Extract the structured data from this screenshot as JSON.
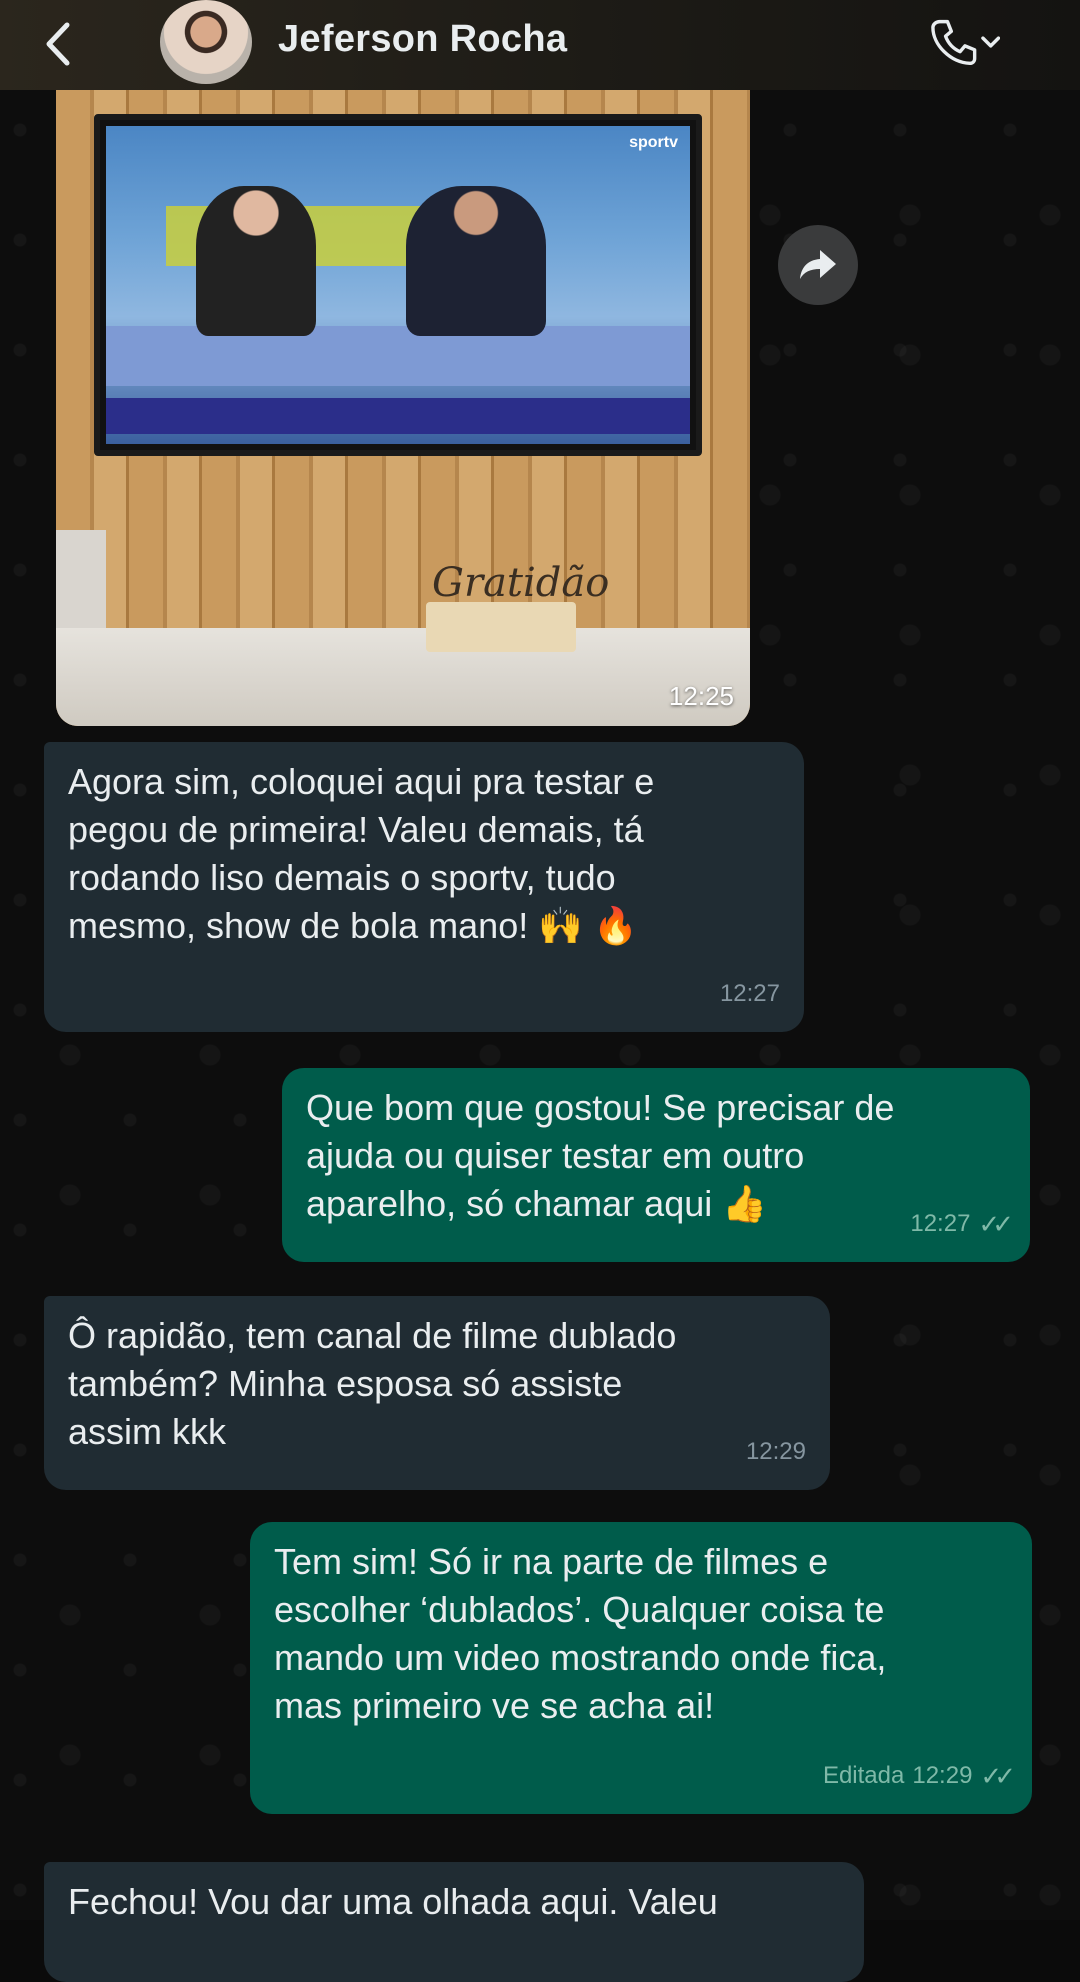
{
  "header": {
    "contact_name": "Jeferson Rocha",
    "back_icon": "chevron-left-icon",
    "call_icon": "phone-icon",
    "menu_icon": "chevron-down-icon"
  },
  "media": {
    "time": "12:25",
    "tv_channel_logo": "sportv",
    "forward_icon": "forward-arrow-icon",
    "plaque_text": "Gratidão"
  },
  "messages": [
    {
      "direction": "incoming",
      "text": "Agora sim, coloquei aqui pra testar e\npegou de primeira! Valeu demais, tá\nrodando liso demais o sportv, tudo\nmesmo, show de bola mano! 🙌 🔥",
      "time": "12:27"
    },
    {
      "direction": "outgoing",
      "text": "Que bom que gostou! Se precisar de\najuda ou quiser testar em outro\naparelho, só chamar aqui 👍",
      "time": "12:27"
    },
    {
      "direction": "incoming",
      "text": "Ô rapidão, tem canal de filme dublado\ntambém? Minha esposa só assiste\nassim kkk",
      "time": "12:29"
    },
    {
      "direction": "outgoing",
      "text": "Tem sim! Só ir na parte de filmes e\nescolher ‘dublados’. Qualquer coisa te\nmando um video mostrando onde fica,\nmas primeiro ve se acha ai!",
      "edited_label": "Editada",
      "time": "12:29"
    },
    {
      "direction": "incoming",
      "text": "Fechou! Vou dar uma olhada aqui. Valeu"
    }
  ],
  "colors": {
    "incoming_bubble": "#202c33",
    "outgoing_bubble": "#005c4b",
    "background": "#0b0b0b"
  }
}
